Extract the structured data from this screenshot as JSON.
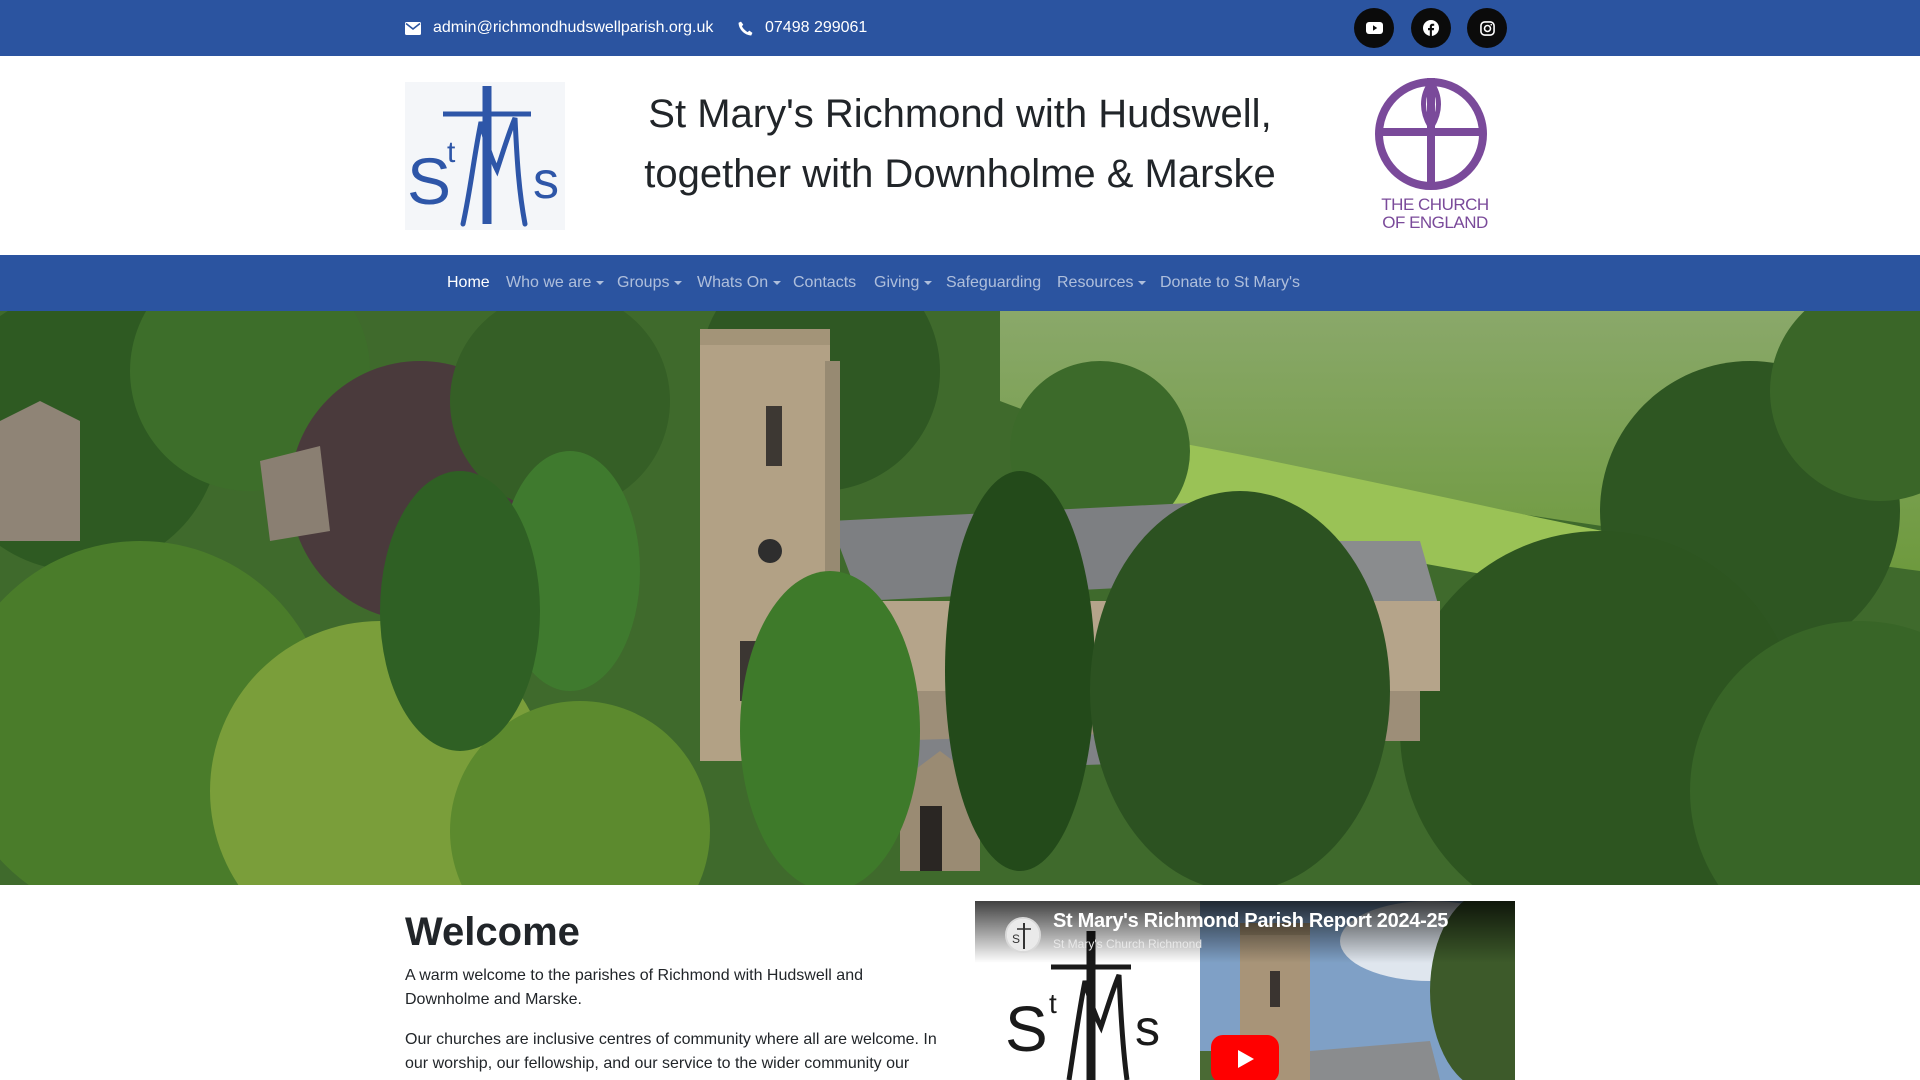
{
  "topbar": {
    "email": "admin@richmondhudswellparish.org.uk",
    "phone": "07498 299061",
    "social": [
      {
        "name": "youtube-icon"
      },
      {
        "name": "facebook-icon"
      },
      {
        "name": "instagram-icon"
      }
    ],
    "background": "#2b54a0"
  },
  "header": {
    "logo_text": "StMs",
    "title_line1": "St Mary's Richmond with Hudswell,",
    "title_line2": "together with Downholme & Marske",
    "coe_line1": "THE CHURCH",
    "coe_line2": "OF ENGLAND"
  },
  "nav": {
    "items": [
      {
        "label": "Home",
        "active": true,
        "dropdown": false
      },
      {
        "label": "Who we are",
        "active": false,
        "dropdown": true
      },
      {
        "label": "Groups",
        "active": false,
        "dropdown": true
      },
      {
        "label": "Whats On",
        "active": false,
        "dropdown": true
      },
      {
        "label": "Contacts",
        "active": false,
        "dropdown": false
      },
      {
        "label": "Giving",
        "active": false,
        "dropdown": true
      },
      {
        "label": "Safeguarding",
        "active": false,
        "dropdown": false
      },
      {
        "label": "Resources",
        "active": false,
        "dropdown": true
      },
      {
        "label": "Donate to St Mary's",
        "active": false,
        "dropdown": false
      }
    ]
  },
  "welcome": {
    "title": "Welcome",
    "p1": "A warm welcome to the parishes of Richmond with Hudswell and Downholme and Marske.",
    "p2": "Our churches are inclusive centres of community where all are welcome. In our worship, our fellowship, and our service to the wider community our"
  },
  "video": {
    "title": "St Mary's Richmond Parish Report 2024-25",
    "channel": "St Mary's Church Richmond"
  },
  "colors": {
    "brand_blue": "#2b54a0",
    "logo_blue": "#2e56a8",
    "coe_purple": "#7a4a9a"
  }
}
